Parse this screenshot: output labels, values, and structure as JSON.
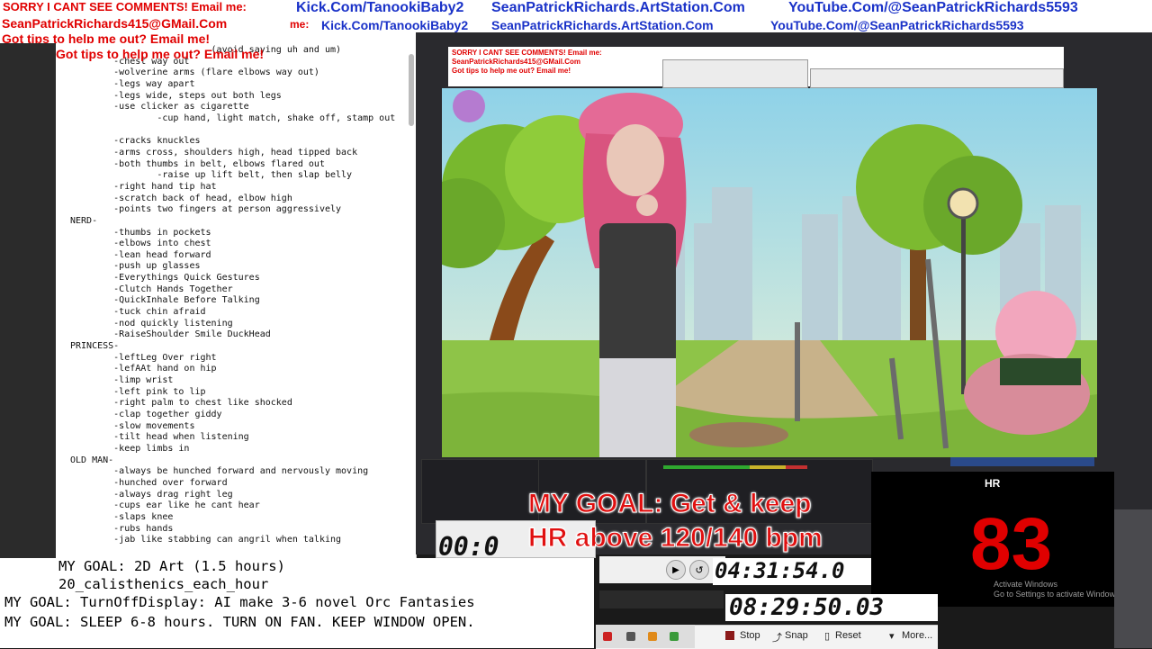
{
  "banner": {
    "line1_red": "SORRY I CANT SEE COMMENTS! Email me:",
    "line1_kick": "Kick.Com/TanookiBaby2",
    "line1_art": "SeanPatrickRichards.ArtStation.Com",
    "line1_yt": "YouTube.Com/@SeanPatrickRichards5593",
    "line2_email": "SeanPatrickRichards415@GMail.Com",
    "line2_me": "me:",
    "line2_kick": "Kick.Com/TanookiBaby2",
    "line2_art": "SeanPatrickRichards.ArtStation.Com",
    "line2_yt": "YouTube.Com/@SeanPatrickRichards5593",
    "line3_tips": "Got tips to help me out? Email me!",
    "line4_tips": "Got tips to help me out? Email me!"
  },
  "notes": {
    "lines": [
      "                          (avoid saying uh and um)",
      "        -chest way out",
      "        -wolverine arms (flare elbows way out)",
      "        -legs way apart",
      "        -legs wide, steps out both legs",
      "        -use clicker as cigarette",
      "                -cup hand, light match, shake off, stamp out",
      "",
      "        -cracks knuckles",
      "        -arms cross, shoulders high, head tipped back",
      "        -both thumbs in belt, elbows flared out",
      "                -raise up lift belt, then slap belly",
      "        -right hand tip hat",
      "        -scratch back of head, elbow high",
      "        -points two fingers at person aggressively",
      "NERD-",
      "        -thumbs in pockets",
      "        -elbows into chest",
      "        -lean head forward",
      "        -push up glasses",
      "        -Everythings Quick Gestures",
      "        -Clutch Hands Together",
      "        -QuickInhale Before Talking",
      "        -tuck chin afraid",
      "        -nod quickly listening",
      "        -RaiseShoulder Smile DuckHead",
      "PRINCESS-",
      "        -leftLeg Over right",
      "        -lefAAt hand on hip",
      "        -limp wrist",
      "        -left pink to lip",
      "        -right palm to chest like shocked",
      "        -clap together giddy",
      "        -slow movements",
      "        -tilt head when listening",
      "        -keep limbs in",
      "OLD MAN-",
      "        -always be hunched forward and nervously moving",
      "        -hunched over forward",
      "        -always drag right leg",
      "        -cups ear like he cant hear",
      "        -slaps knee",
      "        -rubs hands",
      "        -jab like stabbing can angril when talking"
    ]
  },
  "goals": {
    "g1": "MY GOAL: 2D Art (1.5 hours)",
    "g2": "20_calisthenics_each_hour",
    "g3": "MY GOAL: TurnOffDisplay: AI make 3-6 novel Orc Fantasies",
    "g4": "MY GOAL: SLEEP 6-8 hours. TURN ON FAN. KEEP WINDOW OPEN."
  },
  "overlay": {
    "goal1": "MY GOAL: Get & keep",
    "goal2": "HR above 120/140 bpm",
    "hr_label": "HR",
    "hr_value": "83",
    "activate1": "Activate Windows",
    "activate2": "Go to Settings to activate Windows."
  },
  "timers": {
    "stopwatch": "00:0",
    "elapsed": "04:31:54.0",
    "clock": "08:29:50.03"
  },
  "statusbar": {
    "stop": "Stop",
    "snap": "Snap",
    "reset": "Reset",
    "more": "More..."
  },
  "colors": {
    "accent_red": "#e00000",
    "link_blue": "#1a32c8"
  }
}
